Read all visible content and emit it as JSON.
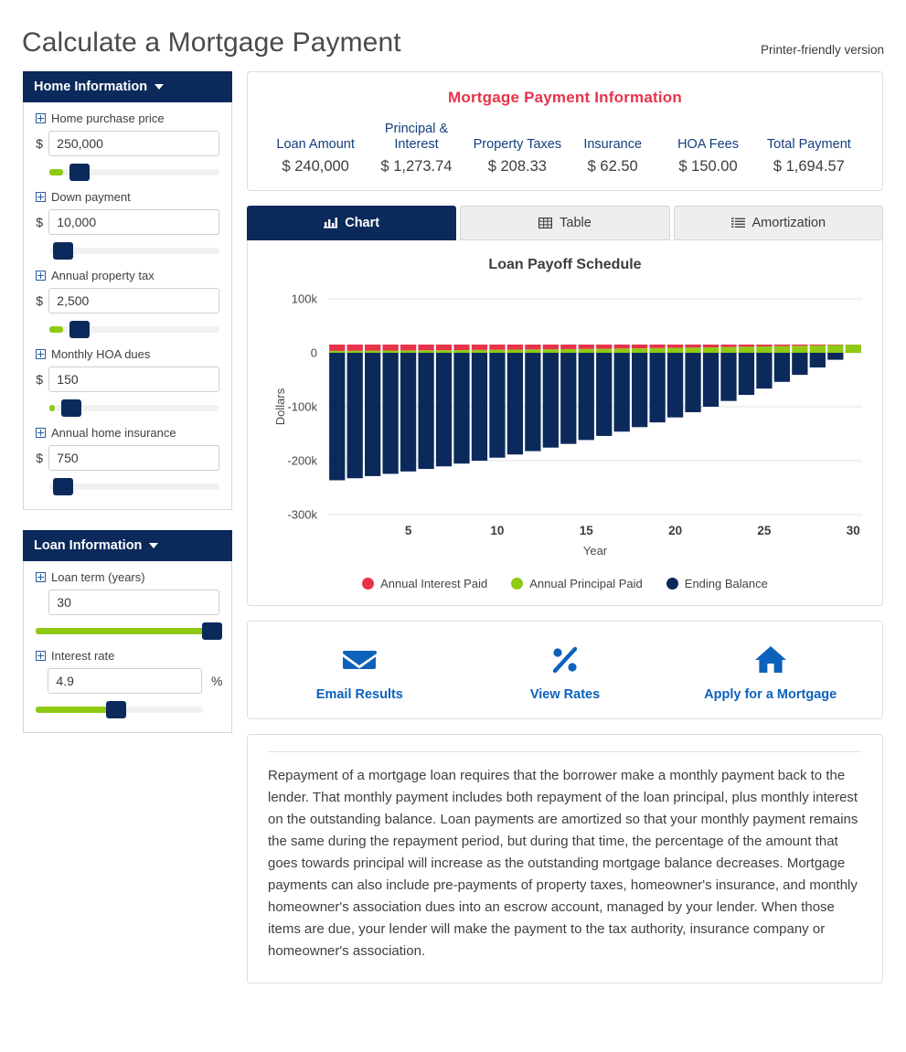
{
  "header": {
    "title": "Calculate a Mortgage Payment",
    "printer_link": "Printer-friendly version"
  },
  "colors": {
    "navy": "#0b2a5b",
    "green": "#8fc914",
    "red": "#e8334a",
    "blue_link": "#0c62bb",
    "heading_blue": "#143f7c",
    "track": "#f1f1f1"
  },
  "sidebar": {
    "panels": [
      {
        "title": "Home Information",
        "caret": "chevron-down-icon",
        "fields": [
          {
            "label": "Home purchase price",
            "prefix": "$",
            "suffix": "",
            "value": "250,000",
            "slider_pct": 18,
            "fill_pct": 8
          },
          {
            "label": "Down payment",
            "prefix": "$",
            "suffix": "",
            "value": "10,000",
            "slider_pct": 8,
            "fill_pct": 0
          },
          {
            "label": "Annual property tax",
            "prefix": "$",
            "suffix": "",
            "value": "2,500",
            "slider_pct": 18,
            "fill_pct": 8
          },
          {
            "label": "Monthly HOA dues",
            "prefix": "$",
            "suffix": "",
            "value": "150",
            "slider_pct": 13,
            "fill_pct": 3
          },
          {
            "label": "Annual home insurance",
            "prefix": "$",
            "suffix": "",
            "value": "750",
            "slider_pct": 8,
            "fill_pct": 0
          }
        ]
      },
      {
        "title": "Loan Information",
        "caret": "chevron-down-icon",
        "fields": [
          {
            "label": "Loan term (years)",
            "prefix": "",
            "suffix": "",
            "value": "30",
            "slider_pct": 96,
            "fill_pct": 96
          },
          {
            "label": "Interest rate",
            "prefix": "",
            "suffix": "%",
            "value": "4.9",
            "slider_pct": 48,
            "fill_pct": 48
          }
        ]
      }
    ]
  },
  "summary": {
    "title": "Mortgage Payment Information",
    "items": [
      {
        "label": "Loan Amount",
        "value": "$ 240,000"
      },
      {
        "label": "Principal & Interest",
        "value": "$ 1,273.74"
      },
      {
        "label": "Property Taxes",
        "value": "$ 208.33"
      },
      {
        "label": "Insurance",
        "value": "$ 62.50"
      },
      {
        "label": "HOA Fees",
        "value": "$ 150.00"
      },
      {
        "label": "Total Payment",
        "value": "$ 1,694.57"
      }
    ]
  },
  "tabs": [
    {
      "label": "Chart",
      "icon": "bar-chart-icon",
      "active": true
    },
    {
      "label": "Table",
      "icon": "table-grid-icon",
      "active": false
    },
    {
      "label": "Amortization",
      "icon": "list-icon",
      "active": false
    }
  ],
  "chart_data": {
    "type": "bar",
    "title": "Loan Payoff Schedule",
    "xlabel": "Year",
    "ylabel": "Dollars",
    "ylim": [
      -300000,
      100000
    ],
    "ytick_labels": [
      "100k",
      "0",
      "-100k",
      "-200k",
      "-300k"
    ],
    "yticks": [
      100000,
      0,
      -100000,
      -200000,
      -300000
    ],
    "xtick_labels": [
      "5",
      "10",
      "15",
      "20",
      "25",
      "30"
    ],
    "xticks": [
      5,
      10,
      15,
      20,
      25,
      30
    ],
    "grid": true,
    "legend_position": "bottom",
    "categories": [
      1,
      2,
      3,
      4,
      5,
      6,
      7,
      8,
      9,
      10,
      11,
      12,
      13,
      14,
      15,
      16,
      17,
      18,
      19,
      20,
      21,
      22,
      23,
      24,
      25,
      26,
      27,
      28,
      29,
      30
    ],
    "series": [
      {
        "name": "Annual Interest Paid",
        "color": "#e8334a",
        "values": [
          11684,
          11499,
          11305,
          11102,
          10888,
          10664,
          10429,
          10182,
          9923,
          9651,
          9366,
          9066,
          8752,
          8422,
          8075,
          7711,
          7329,
          6928,
          6506,
          6064,
          5600,
          5112,
          4600,
          4063,
          3498,
          2906,
          2284,
          1630,
          944,
          223
        ]
      },
      {
        "name": "Annual Principal Paid",
        "color": "#8fc914",
        "values": [
          3601,
          3786,
          3980,
          4183,
          4397,
          4621,
          4856,
          5103,
          5362,
          5634,
          5919,
          6219,
          6533,
          6863,
          7210,
          7574,
          7956,
          8357,
          8779,
          9221,
          9685,
          10173,
          10685,
          11222,
          11787,
          12379,
          13001,
          13655,
          14341,
          15062
        ]
      },
      {
        "name": "Ending Balance",
        "color": "#0b2a5b",
        "values": [
          -236399,
          -232613,
          -228633,
          -224450,
          -220053,
          -215432,
          -210576,
          -205473,
          -200111,
          -194477,
          -188558,
          -182339,
          -175806,
          -168943,
          -161733,
          -154159,
          -146203,
          -137846,
          -129067,
          -119846,
          -110161,
          -99988,
          -89303,
          -78081,
          -66294,
          -53915,
          -40914,
          -27259,
          -12918,
          0
        ]
      }
    ]
  },
  "actions": [
    {
      "label": "Email Results",
      "icon": "envelope-icon"
    },
    {
      "label": "View Rates",
      "icon": "percent-icon"
    },
    {
      "label": "Apply for a Mortgage",
      "icon": "house-icon"
    }
  ],
  "description": {
    "text": "Repayment of a mortgage loan requires that the borrower make a monthly payment back to the lender. That monthly payment includes both repayment of the loan principal, plus monthly interest on the outstanding balance. Loan payments are amortized so that your monthly payment remains the same during the repayment period, but during that time, the percentage of the amount that goes towards principal will increase as the outstanding mortgage balance decreases. Mortgage payments can also include pre-payments of property taxes, homeowner's insurance, and monthly homeowner's association dues into an escrow account, managed by your lender. When those items are due, your lender will make the payment to the tax authority, insurance company or homeowner's association."
  }
}
